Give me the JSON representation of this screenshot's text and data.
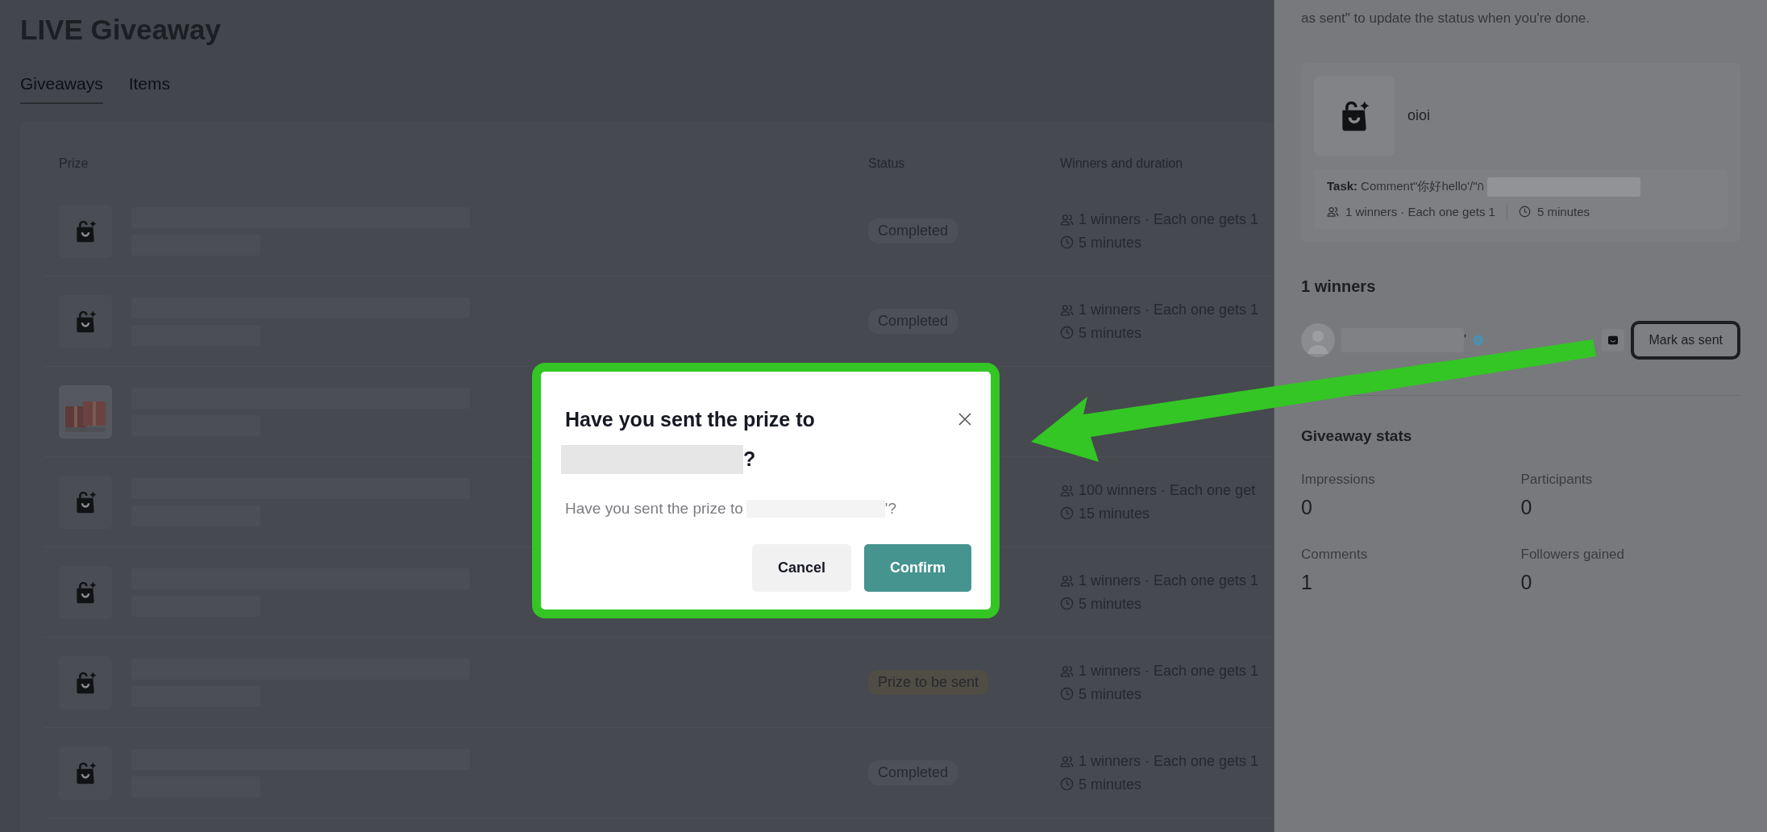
{
  "page": {
    "title": "LIVE Giveaway"
  },
  "tabs": [
    {
      "label": "Giveaways",
      "selected": true
    },
    {
      "label": "Items",
      "selected": false
    }
  ],
  "table": {
    "columns": [
      "Prize",
      "Status",
      "Winners and duration"
    ],
    "rows": [
      {
        "kind": "bag",
        "status": "Completed",
        "color": "#4d5056",
        "winners": "1 winners · Each one gets 1",
        "duration": "5 minutes"
      },
      {
        "kind": "bag",
        "status": "Completed",
        "color": "#4d5056",
        "winners": "1 winners · Each one gets 1",
        "duration": "5 minutes"
      },
      {
        "kind": "picture"
      },
      {
        "kind": "bag",
        "winners": "100 winners · Each one get",
        "duration": "15 minutes"
      },
      {
        "kind": "bag",
        "winners": "1 winners · Each one gets 1",
        "duration": "5 minutes"
      },
      {
        "kind": "bag",
        "status": "Prize to be sent",
        "color": "#504d45",
        "winners": "1 winners · Each one gets 1",
        "duration": "5 minutes"
      },
      {
        "kind": "bag",
        "status": "Completed",
        "color": "#4d5056",
        "winners": "1 winners · Each one gets 1",
        "duration": "5 minutes"
      }
    ]
  },
  "panel": {
    "intro": "as sent\" to update the status when you're done.",
    "prize": {
      "name": "oioi",
      "task_label": "Task:",
      "task": "Comment\"你好hello'/\"ก",
      "winners": "1 winners · Each one gets 1",
      "duration": "5 minutes"
    },
    "winners_heading": "1 winners",
    "winner": {
      "name_end": "'",
      "verified": true,
      "action": "Mark as sent"
    },
    "stats_heading": "Giveaway stats",
    "stats": [
      {
        "label": "Impressions",
        "value": "0"
      },
      {
        "label": "Participants",
        "value": "0"
      },
      {
        "label": "Comments",
        "value": "1"
      },
      {
        "label": "Followers gained",
        "value": "0"
      }
    ]
  },
  "dialog": {
    "title": "Have you sent the prize to",
    "title_end": "?",
    "message": "Have you sent the prize to",
    "message_end": "'?",
    "buttons": [
      {
        "label": "Cancel",
        "kind": "secondary"
      },
      {
        "label": "Confirm",
        "kind": "primary"
      }
    ]
  }
}
